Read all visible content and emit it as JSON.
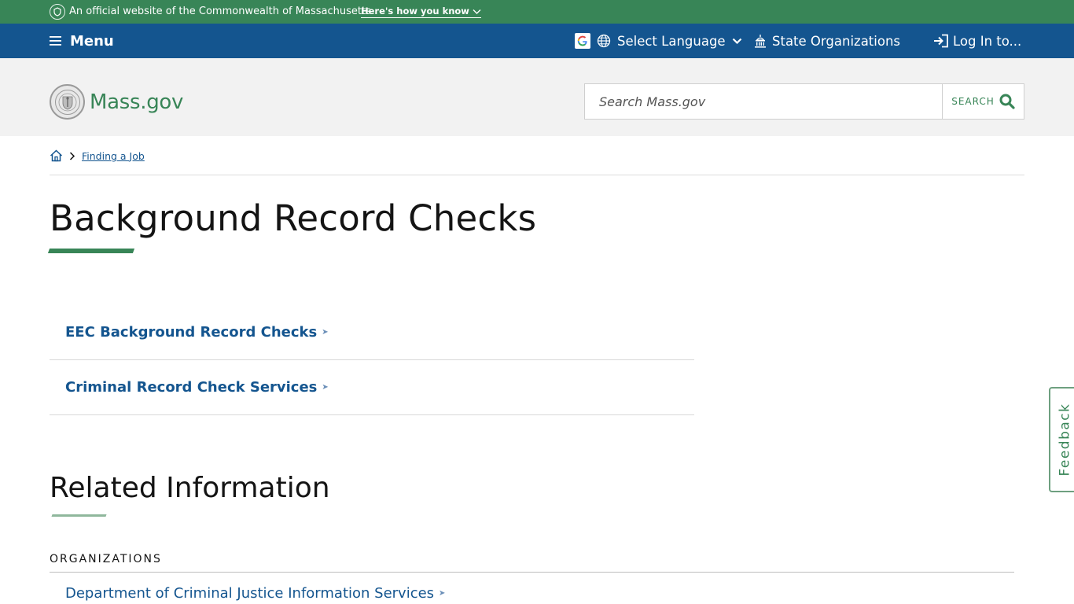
{
  "official_banner": {
    "text": "An official website of the Commonwealth of Massachusetts",
    "link": "Here's how you know"
  },
  "utility_nav": {
    "menu": "Menu",
    "language": "Select Language",
    "state_orgs": "State Organizations",
    "login": "Log In to..."
  },
  "header": {
    "logo_text": "Mass.gov",
    "search_placeholder": "Search Mass.gov",
    "search_button": "SEARCH"
  },
  "breadcrumb": {
    "items": [
      "Finding a Job"
    ]
  },
  "page": {
    "title": "Background Record Checks",
    "links": [
      "EEC Background Record Checks",
      "Criminal Record Check Services"
    ]
  },
  "related": {
    "title": "Related Information",
    "section_label": "ORGANIZATIONS",
    "organizations": [
      "Department of Criminal Justice Information Services"
    ]
  },
  "feedback": "Feedback",
  "colors": {
    "green": "#388557",
    "blue": "#14558f",
    "header_bg": "#f2f2f2"
  }
}
